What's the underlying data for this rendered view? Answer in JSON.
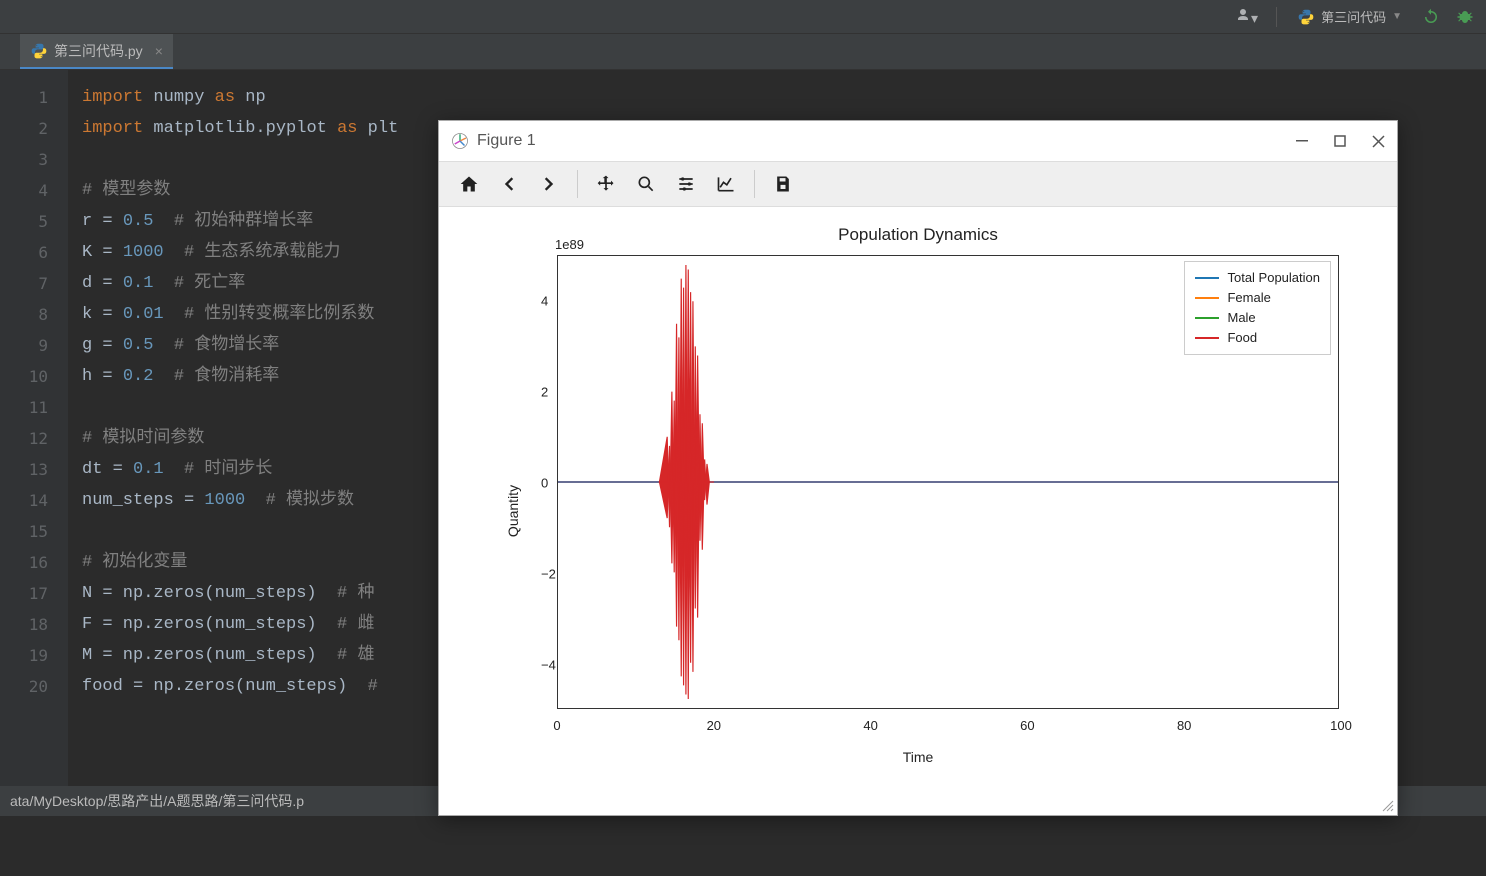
{
  "toolbar": {
    "run_config": "第三问代码"
  },
  "tabs": [
    {
      "label": "第三问代码.py"
    }
  ],
  "editor": {
    "line_count": 20,
    "code_lines": [
      {
        "t": "import",
        "r": " numpy ",
        "a": "as",
        "r2": " np"
      },
      {
        "t": "import",
        "r": " matplotlib.pyplot ",
        "a": "as",
        "r2": " plt"
      },
      {
        "blank": true
      },
      {
        "c": "# 模型参数"
      },
      {
        "assign": "r = ",
        "n": "0.5",
        "sp": "  ",
        "c": "# 初始种群增长率"
      },
      {
        "assign": "K = ",
        "n": "1000",
        "sp": "  ",
        "c": "# 生态系统承载能力"
      },
      {
        "assign": "d = ",
        "n": "0.1",
        "sp": "  ",
        "c": "# 死亡率"
      },
      {
        "assign": "k = ",
        "n": "0.01",
        "sp": "  ",
        "c": "# 性别转变概率比例系数"
      },
      {
        "assign": "g = ",
        "n": "0.5",
        "sp": "  ",
        "c": "# 食物增长率"
      },
      {
        "assign": "h = ",
        "n": "0.2",
        "sp": "  ",
        "c": "# 食物消耗率"
      },
      {
        "blank": true
      },
      {
        "c": "# 模拟时间参数"
      },
      {
        "assign": "dt = ",
        "n": "0.1",
        "sp": "  ",
        "c": "# 时间步长"
      },
      {
        "assign": "num_steps = ",
        "n": "1000",
        "sp": "  ",
        "c": "# 模拟步数"
      },
      {
        "blank": true
      },
      {
        "c": "# 初始化变量"
      },
      {
        "raw": "N = np.zeros(num_steps)  ",
        "c": "# 种"
      },
      {
        "raw": "F = np.zeros(num_steps)  ",
        "c": "# 雌"
      },
      {
        "raw": "M = np.zeros(num_steps)  ",
        "c": "# 雄"
      },
      {
        "raw": "food = np.zeros(num_steps)  ",
        "c": "#"
      }
    ]
  },
  "status": {
    "path": "ata/MyDesktop/思路产出/A题思路/第三问代码.p"
  },
  "figure": {
    "title": "Figure 1",
    "toolbar_icons": [
      "home",
      "back",
      "forward",
      "pan",
      "zoom",
      "configure",
      "plot",
      "save"
    ]
  },
  "chart_data": {
    "type": "line",
    "title": "Population Dynamics",
    "xlabel": "Time",
    "ylabel": "Quantity",
    "y_exponent": "1e89",
    "xlim": [
      0,
      100
    ],
    "ylim": [
      -5,
      5
    ],
    "x_ticks": [
      0,
      20,
      40,
      60,
      80,
      100
    ],
    "y_ticks": [
      -4,
      -2,
      0,
      2,
      4
    ],
    "series": [
      {
        "name": "Total Population",
        "color": "#1f77b4",
        "note": "overlapped near y=0"
      },
      {
        "name": "Female",
        "color": "#ff7f0e",
        "note": "overlapped near y=0"
      },
      {
        "name": "Male",
        "color": "#2ca02c",
        "note": "overlapped near y=0"
      },
      {
        "name": "Food",
        "color": "#d62728",
        "note": "large oscillation burst around x≈16 spanning approx -5e89 to +5e89, flat ≈0 elsewhere"
      }
    ],
    "description": "All series appear flat near 0 from x=0 to ~100 except Food which shows a dense high-amplitude oscillation burst (~±5e89) centered near x≈15–18, then flat at ~0 afterward."
  }
}
